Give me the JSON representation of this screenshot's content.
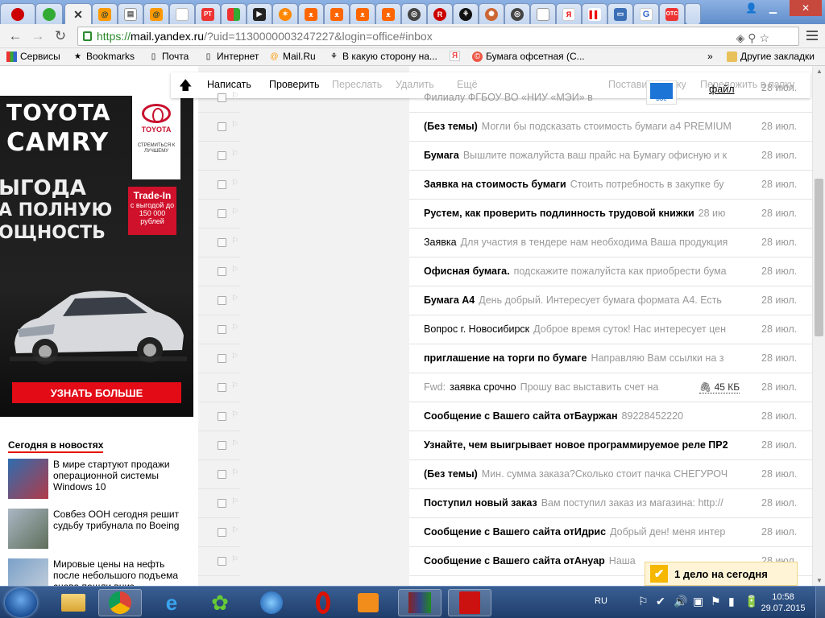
{
  "browser": {
    "tab_favicons": [
      "yandex-icon",
      "green-dot-icon",
      "mail-active",
      "mail-ru-icon",
      "doc-icon",
      "mail-ru-icon",
      "blank-icon",
      "rt-icon",
      "grid-icon",
      "play-icon",
      "compass-icon",
      "people-icon",
      "people-icon",
      "people-icon",
      "people-icon",
      "circle-icon",
      "circle-icon",
      "r-icon",
      "eagle-icon",
      "octopus-icon",
      "circle-icon",
      "page-icon",
      "yandex-icon",
      "yandex-icon",
      "red-bars-icon",
      "chat-icon",
      "google-icon",
      "otc-icon"
    ],
    "tabs": [
      {
        "label": "РТ"
      },
      {
        "label": "Я"
      },
      {
        "label": "Я"
      },
      {
        "label": "G"
      },
      {
        "label": "ОТС"
      }
    ],
    "url_secure": "https://",
    "url_host": "mail.yandex.ru",
    "url_rest": "/?uid=1130000003247227&login=office#inbox",
    "bookmarks": [
      {
        "label": "Сервисы"
      },
      {
        "label": "Bookmarks"
      },
      {
        "label": "Почта"
      },
      {
        "label": "Интернет"
      },
      {
        "label": "Mail.Ru"
      },
      {
        "label": "В какую сторону на..."
      },
      {
        "label": "Я"
      },
      {
        "label": "Бумага офсетная (С..."
      }
    ],
    "more_bookmarks_chevron": "»",
    "other_bookmarks": "Другие закладки"
  },
  "ad": {
    "brand": "TOYOTA",
    "model": "CAMRY",
    "logo_word": "TOYOTA",
    "slogan": "СТРЕМИТЬСЯ К ЛУЧШЕМУ",
    "headline_1": "ЫГОДА",
    "headline_2": "А ПОЛНУЮ",
    "headline_3": "ОЩНОСТЬ",
    "tradein_title": "Trade-In",
    "tradein_text": "с выгодой до 150 000 рублей",
    "button": "УЗНАТЬ БОЛЬШЕ"
  },
  "news": {
    "heading": "Сегодня в новостях",
    "items": [
      {
        "text": "В мире стартуют продажи операционной системы Windows 10"
      },
      {
        "text": "Совбез ООН сегодня решит судьбу трибунала по Boeing"
      },
      {
        "text": "Мировые цены на нефть после небольшого подъема снова пошли вниз"
      }
    ]
  },
  "toolbar": {
    "write": "Написать",
    "check": "Проверить",
    "forward": "Переслать",
    "delete": "Удалить",
    "more": "Ещё",
    "label": "Поставить метку",
    "move": "Переложить в папку"
  },
  "messages": [
    {
      "subject": "",
      "snippet": "Филиалу ФГБОУ ВО «НИУ «МЭИ» в",
      "date": "28 июл.",
      "bold": false,
      "attachment_doc": true,
      "doc_label": "DOC",
      "file": "файл"
    },
    {
      "subject": "(Без темы)",
      "snippet": "Могли бы подсказать стоимость бумаги а4 PREMIUM",
      "date": "28 июл.",
      "bold": true
    },
    {
      "subject": "Бумага",
      "snippet": "Вышлите пожалуйста ваш прайс на Бумагу офисную и к",
      "date": "28 июл.",
      "bold": true
    },
    {
      "subject": "Заявка на стоимость бумаги",
      "snippet": "Стоить потребность в закупке бу",
      "date": "28 июл.",
      "bold": true
    },
    {
      "subject": "Рустем, как проверить подлинность трудовой книжки",
      "snippet": "28 ию",
      "date": "28 июл.",
      "bold": true
    },
    {
      "subject": "Заявка",
      "snippet": "Для участия в тендере нам необходима Ваша продукция",
      "date": "28 июл.",
      "bold": false
    },
    {
      "subject": "Офисная бумага.",
      "snippet": "подскажите пожалуйста как приобрести бума",
      "date": "28 июл.",
      "bold": true
    },
    {
      "subject": "Бумага А4",
      "snippet": "День добрый. Интересует бумага формата А4. Есть",
      "date": "28 июл.",
      "bold": true
    },
    {
      "subject": "Вопрос г. Новосибирск",
      "snippet": "Доброе время суток! Нас интересует цен",
      "date": "28 июл.",
      "bold": false
    },
    {
      "subject": "приглашение на торги по бумаге",
      "snippet": "Направляю Вам ссылки на з",
      "date": "28 июл.",
      "bold": true
    },
    {
      "prefix": "Fwd:",
      "subject": "заявка срочно",
      "snippet": "Прошу вас выставить счет на",
      "date": "28 июл.",
      "bold": false,
      "attachment": "45 КБ"
    },
    {
      "subject": "Сообщение с Вашего сайта отБауржан",
      "snippet": "89228452220",
      "date": "28 июл.",
      "bold": true
    },
    {
      "subject": "Узнайте, чем выигрывает новое программируемое реле ПР2",
      "snippet": "",
      "date": "28 июл.",
      "bold": true
    },
    {
      "subject": "(Без темы)",
      "snippet": "Мин. сумма заказа?Сколько стоит пачка СНЕГУРОЧ",
      "date": "28 июл.",
      "bold": true
    },
    {
      "subject": "Поступил новый заказ",
      "snippet": "Вам поступил заказ из магазина: http://",
      "date": "28 июл.",
      "bold": true
    },
    {
      "subject": "Сообщение с Вашего сайта отИдрис",
      "snippet": "Добрый ден! меня интер",
      "date": "28 июл.",
      "bold": true
    },
    {
      "subject": "Сообщение с Вашего сайта отАнуар",
      "snippet": "Наша",
      "date": "28 июл.",
      "bold": true
    }
  ],
  "todo": {
    "text": "1 дело на сегодня"
  },
  "taskbar": {
    "lang": "RU",
    "time": "10:58",
    "date": "29.07.2015"
  }
}
